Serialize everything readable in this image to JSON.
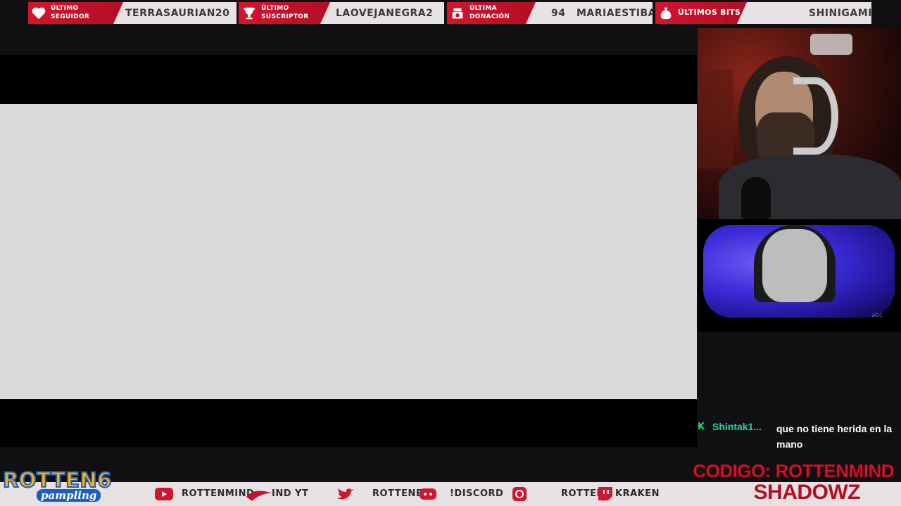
{
  "alerts_bar": {
    "follower": {
      "label_line1": "Último",
      "label_line2": "Seguidor",
      "value": "TERRASAURIAN20"
    },
    "subscriber": {
      "label_line1": "Último",
      "label_line2": "Suscriptor",
      "value": "LAOVEJANEGRA2"
    },
    "donation": {
      "label_line1": "Última",
      "label_line2": "Donación",
      "value_amount": "94",
      "value_name": "MARIAESTIBA"
    },
    "bits": {
      "label": "Últimos bits",
      "value": "SHINIGAMI"
    }
  },
  "webcam": {
    "icon": "streamer-webcam"
  },
  "clip": {
    "logo": "abc"
  },
  "chat": {
    "messages": [
      {
        "badge": "K",
        "user": "Shintak1...",
        "text": "que no tiene herida en la mano"
      }
    ]
  },
  "bottom_bar": {
    "youtube": "ROTTENMIND",
    "youtube2": "IND YT",
    "twitter": "ROTTENE",
    "discord": "!DISCORD",
    "instagram": "ROTTEI",
    "twitch": "KRAKEN"
  },
  "branding": {
    "logo_main": "ROTTEN6",
    "logo_sub": "pampling",
    "code_label": "CODIGO: ROTTENMIND",
    "code_sub": "SHADOWZ"
  },
  "colors": {
    "accent_red": "#d4142f",
    "chat_user": "#1fd3a7",
    "logo_yellow": "#ffb100",
    "logo_blue": "#1b5fc2"
  }
}
